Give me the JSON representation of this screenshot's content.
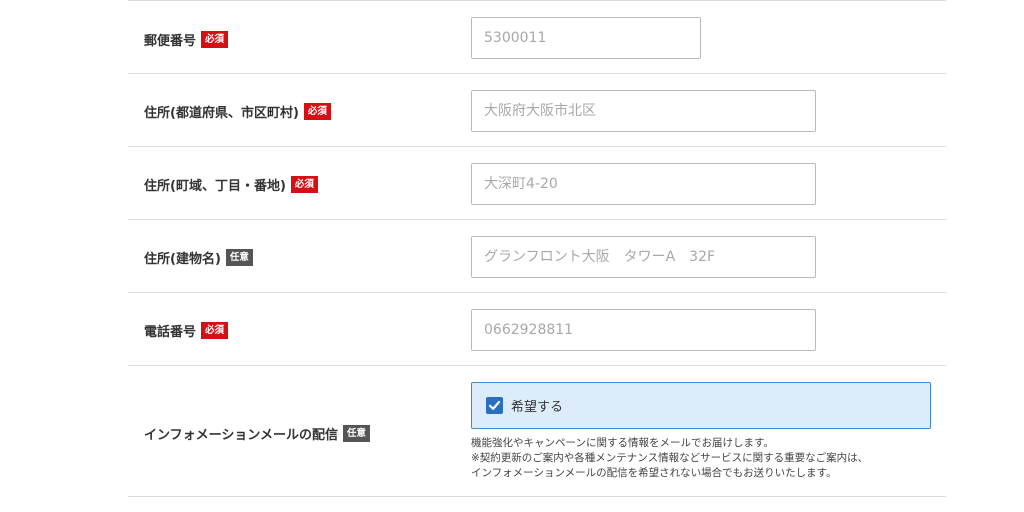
{
  "badges": {
    "required": "必須",
    "optional": "任意"
  },
  "fields": [
    {
      "label": "郵便番号",
      "badge": "必須",
      "placeholder": "5300011"
    },
    {
      "label": "住所(都道府県、市区町村)",
      "badge": "必須",
      "placeholder": "大阪府大阪市北区"
    },
    {
      "label": "住所(町域、丁目・番地)",
      "badge": "必須",
      "placeholder": "大深町4-20"
    },
    {
      "label": "住所(建物名)",
      "badge": "任意",
      "placeholder": "グランフロント大阪　タワーA　32F"
    },
    {
      "label": "電話番号",
      "badge": "必須",
      "placeholder": "0662928811"
    }
  ],
  "newsletter": {
    "label": "インフォメーションメールの配信",
    "badge": "任意",
    "checkbox_label": "希望する",
    "checked": true,
    "note_lines": [
      "機能強化やキャンペーンに関する情報をメールでお届けします。",
      "※契約更新のご案内や各種メンテナンス情報などサービスに関する重要なご案内は、",
      "インフォメーションメールの配信を希望されない場合でもお送りいたします。"
    ]
  },
  "colors": {
    "required_badge": "#d50f14",
    "optional_badge": "#555555",
    "checkbox_bg": "#dcecfb",
    "checkbox_border": "#3f8ad2"
  }
}
